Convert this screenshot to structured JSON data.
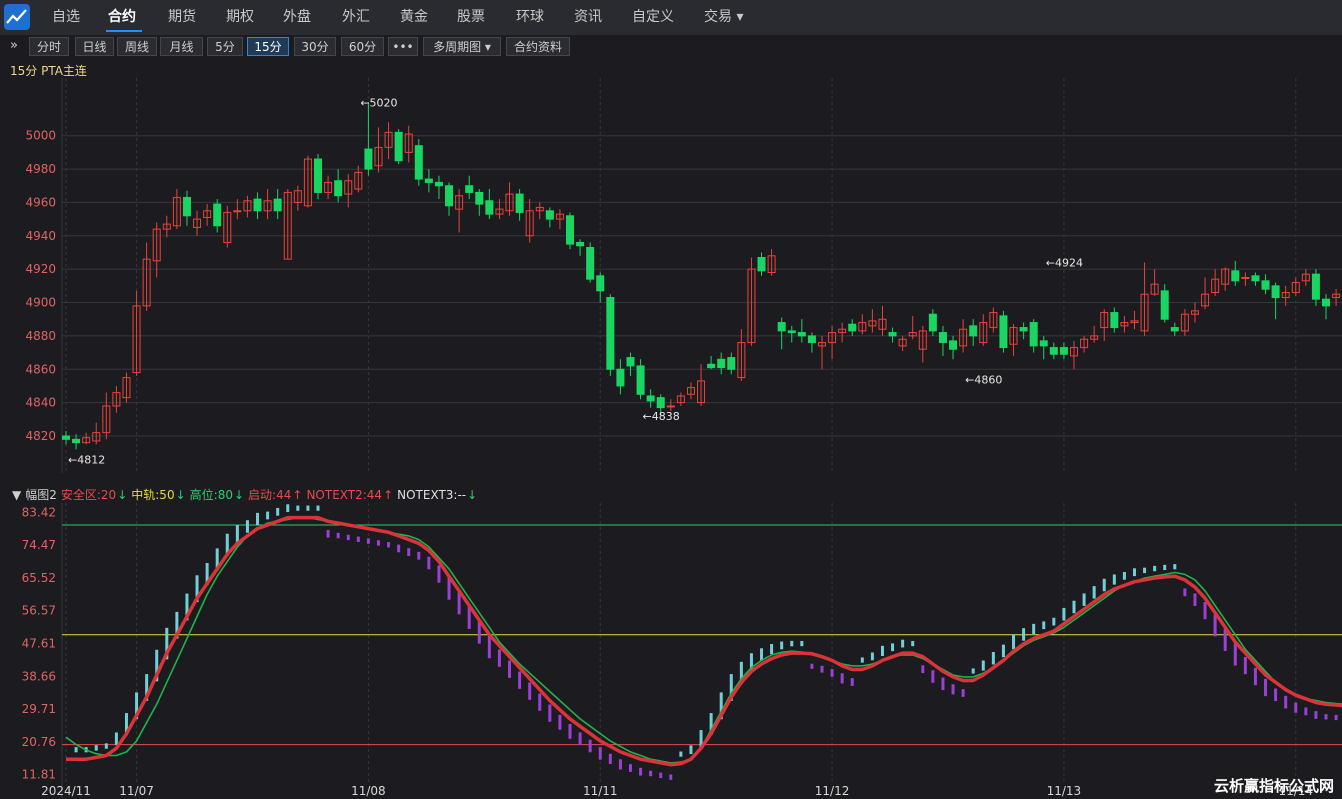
{
  "nav": {
    "items": [
      "自选",
      "合约",
      "期货",
      "期权",
      "外盘",
      "外汇",
      "黄金",
      "股票",
      "环球",
      "资讯",
      "自定义",
      "交易"
    ],
    "active": "合约"
  },
  "toolbar": {
    "collapse": "»",
    "buttons": [
      "分时",
      "日线",
      "周线",
      "月线",
      "5分",
      "15分",
      "30分",
      "60分",
      "•••",
      "多周期图",
      "合约资料"
    ],
    "active": "15分"
  },
  "chart_title": "15分 PTA主连",
  "indicator_legend": {
    "name": "幅图2",
    "items": [
      {
        "text": "安全区:20",
        "color": "#e84a4a",
        "arrow": "↓",
        "arrow_color": "#2ecc71"
      },
      {
        "text": "中轨:50",
        "color": "#e6d94a",
        "arrow": "↓",
        "arrow_color": "#2ecc71"
      },
      {
        "text": "高位:80",
        "color": "#2ecc71",
        "arrow": "↓",
        "arrow_color": "#2ecc71"
      },
      {
        "text": "启动:44",
        "color": "#e84a4a",
        "arrow": "↑",
        "arrow_color": "#e84a4a"
      },
      {
        "text": "NOTEXT2:44",
        "color": "#e84a4a",
        "arrow": "↑",
        "arrow_color": "#e84a4a"
      },
      {
        "text": "NOTEXT3:--",
        "color": "#e0e0e0",
        "arrow": "↓",
        "arrow_color": "#2ecc71"
      }
    ]
  },
  "watermark": "云析赢指标公式网",
  "colors": {
    "up": "#e8433a",
    "down": "#19d663",
    "grid": "#35363c",
    "axis_text": "#e06363"
  },
  "chart_data": [
    {
      "type": "candlestick",
      "title": "15分 PTA主连",
      "ylim": [
        4808,
        5025
      ],
      "yticks": [
        4820,
        4840,
        4860,
        4880,
        4900,
        4920,
        4940,
        4960,
        4980,
        5000
      ],
      "annotations": [
        {
          "label": "←5020",
          "index": 29,
          "value": 5020
        },
        {
          "label": "←4812",
          "index": 0,
          "value": 4812
        },
        {
          "label": "←4838",
          "index": 57,
          "value": 4838
        },
        {
          "label": "←4860",
          "index": 89,
          "value": 4860
        },
        {
          "label": "←4924",
          "index": 97,
          "value": 4924
        }
      ],
      "candles": [
        [
          4820,
          4818,
          4823,
          4815
        ],
        [
          4818,
          4816,
          4821,
          4812
        ],
        [
          4816,
          4819,
          4822,
          4815
        ],
        [
          4817,
          4822,
          4828,
          4815
        ],
        [
          4822,
          4838,
          4846,
          4818
        ],
        [
          4838,
          4846,
          4850,
          4834
        ],
        [
          4843,
          4855,
          4858,
          4840
        ],
        [
          4858,
          4898,
          4907,
          4856
        ],
        [
          4898,
          4926,
          4936,
          4895
        ],
        [
          4925,
          4944,
          4948,
          4915
        ],
        [
          4944,
          4947,
          4952,
          4939
        ],
        [
          4946,
          4963,
          4968,
          4944
        ],
        [
          4963,
          4952,
          4967,
          4946
        ],
        [
          4945,
          4950,
          4955,
          4940
        ],
        [
          4951,
          4955,
          4959,
          4946
        ],
        [
          4959,
          4946,
          4962,
          4942
        ],
        [
          4936,
          4954,
          4958,
          4933
        ],
        [
          4955,
          4955,
          4962,
          4950
        ],
        [
          4955,
          4961,
          4964,
          4951
        ],
        [
          4962,
          4955,
          4966,
          4950
        ],
        [
          4955,
          4961,
          4968,
          4950
        ],
        [
          4962,
          4955,
          4968,
          4950
        ],
        [
          4926,
          4966,
          4968,
          4926
        ],
        [
          4960,
          4967,
          4970,
          4955
        ],
        [
          4958,
          4986,
          4988,
          4957
        ],
        [
          4986,
          4966,
          4989,
          4962
        ],
        [
          4966,
          4972,
          4976,
          4962
        ],
        [
          4973,
          4964,
          4980,
          4960
        ],
        [
          4965,
          4973,
          4977,
          4957
        ],
        [
          4968,
          4978,
          4982,
          4966
        ],
        [
          4992,
          4980,
          5020,
          4976
        ],
        [
          4982,
          4993,
          5005,
          4978
        ],
        [
          4993,
          5002,
          5008,
          4986
        ],
        [
          5002,
          4985,
          5004,
          4983
        ],
        [
          4990,
          5001,
          5006,
          4984
        ],
        [
          4994,
          4974,
          4998,
          4970
        ],
        [
          4974,
          4972,
          4980,
          4966
        ],
        [
          4972,
          4970,
          4976,
          4962
        ],
        [
          4970,
          4958,
          4972,
          4952
        ],
        [
          4956,
          4964,
          4968,
          4942
        ],
        [
          4970,
          4966,
          4976,
          4962
        ],
        [
          4966,
          4959,
          4968,
          4952
        ],
        [
          4961,
          4953,
          4968,
          4950
        ],
        [
          4953,
          4956,
          4962,
          4950
        ],
        [
          4955,
          4965,
          4972,
          4952
        ],
        [
          4965,
          4954,
          4968,
          4949
        ],
        [
          4940,
          4955,
          4962,
          4936
        ],
        [
          4955,
          4957,
          4960,
          4950
        ],
        [
          4955,
          4950,
          4957,
          4945
        ],
        [
          4950,
          4953,
          4956,
          4944
        ],
        [
          4952,
          4935,
          4954,
          4932
        ],
        [
          4936,
          4934,
          4938,
          4928
        ],
        [
          4933,
          4914,
          4936,
          4912
        ],
        [
          4916,
          4907,
          4918,
          4900
        ],
        [
          4903,
          4860,
          4905,
          4856
        ],
        [
          4860,
          4850,
          4866,
          4845
        ],
        [
          4867,
          4862,
          4870,
          4856
        ],
        [
          4862,
          4845,
          4866,
          4842
        ],
        [
          4844,
          4841,
          4848,
          4837
        ],
        [
          4843,
          4837,
          4845,
          4832
        ],
        [
          4838,
          4838,
          4842,
          4835
        ],
        [
          4840,
          4844,
          4846,
          4838
        ],
        [
          4845,
          4849,
          4852,
          4842
        ],
        [
          4840,
          4853,
          4863,
          4838
        ],
        [
          4863,
          4861,
          4868,
          4860
        ],
        [
          4866,
          4861,
          4870,
          4857
        ],
        [
          4867,
          4860,
          4870,
          4857
        ],
        [
          4855,
          4876,
          4884,
          4853
        ],
        [
          4876,
          4920,
          4927,
          4874
        ],
        [
          4927,
          4919,
          4930,
          4916
        ],
        [
          4918,
          4928,
          4932,
          4916
        ],
        [
          4888,
          4883,
          4891,
          4872
        ],
        [
          4883,
          4882,
          4886,
          4876
        ],
        [
          4882,
          4880,
          4890,
          4876
        ],
        [
          4880,
          4876,
          4882,
          4870
        ],
        [
          4874,
          4876,
          4880,
          4860
        ],
        [
          4876,
          4882,
          4886,
          4866
        ],
        [
          4882,
          4884,
          4888,
          4876
        ],
        [
          4887,
          4883,
          4890,
          4880
        ],
        [
          4883,
          4888,
          4893,
          4881
        ],
        [
          4886,
          4889,
          4896,
          4882
        ],
        [
          4884,
          4890,
          4898,
          4880
        ],
        [
          4882,
          4880,
          4885,
          4876
        ],
        [
          4874,
          4878,
          4880,
          4871
        ],
        [
          4880,
          4882,
          4892,
          4878
        ],
        [
          4872,
          4883,
          4886,
          4864
        ],
        [
          4893,
          4883,
          4896,
          4880
        ],
        [
          4882,
          4876,
          4886,
          4868
        ],
        [
          4877,
          4872,
          4880,
          4866
        ],
        [
          4874,
          4884,
          4890,
          4870
        ],
        [
          4886,
          4880,
          4890,
          4874
        ],
        [
          4876,
          4888,
          4893,
          4874
        ],
        [
          4885,
          4894,
          4897,
          4882
        ],
        [
          4892,
          4873,
          4895,
          4870
        ],
        [
          4875,
          4885,
          4887,
          4868
        ],
        [
          4885,
          4883,
          4888,
          4878
        ],
        [
          4888,
          4874,
          4890,
          4870
        ],
        [
          4877,
          4874,
          4880,
          4866
        ],
        [
          4873,
          4869,
          4876,
          4866
        ],
        [
          4873,
          4869,
          4876,
          4866
        ],
        [
          4868,
          4873,
          4877,
          4860
        ],
        [
          4873,
          4878,
          4880,
          4870
        ],
        [
          4878,
          4880,
          4886,
          4876
        ],
        [
          4885,
          4894,
          4896,
          4877
        ],
        [
          4894,
          4885,
          4897,
          4882
        ],
        [
          4886,
          4888,
          4892,
          4882
        ],
        [
          4888,
          4889,
          4895,
          4884
        ],
        [
          4883,
          4905,
          4924,
          4880
        ],
        [
          4905,
          4911,
          4920,
          4904
        ],
        [
          4907,
          4890,
          4911,
          4888
        ],
        [
          4885,
          4883,
          4888,
          4880
        ],
        [
          4883,
          4893,
          4896,
          4880
        ],
        [
          4893,
          4895,
          4900,
          4888
        ],
        [
          4898,
          4905,
          4915,
          4896
        ],
        [
          4906,
          4914,
          4920,
          4904
        ],
        [
          4911,
          4920,
          4921,
          4907
        ],
        [
          4919,
          4913,
          4925,
          4910
        ],
        [
          4915,
          4915,
          4918,
          4910
        ],
        [
          4916,
          4913,
          4918,
          4910
        ],
        [
          4913,
          4908,
          4917,
          4905
        ],
        [
          4910,
          4903,
          4912,
          4890
        ],
        [
          4903,
          4906,
          4910,
          4898
        ],
        [
          4906,
          4912,
          4915,
          4904
        ],
        [
          4913,
          4917,
          4920,
          4910
        ],
        [
          4917,
          4902,
          4920,
          4898
        ],
        [
          4902,
          4898,
          4905,
          4890
        ],
        [
          4903,
          4905,
          4908,
          4898
        ],
        [
          4905,
          4892,
          4910,
          4890
        ],
        [
          4893,
          4886,
          4895,
          4883
        ],
        [
          4886,
          4872,
          4888,
          4866
        ],
        [
          4873,
          4872,
          4882,
          4868
        ],
        [
          4872,
          4864,
          4875,
          4858
        ],
        [
          4870,
          4862,
          4878,
          4858
        ],
        [
          4862,
          4852,
          4864,
          4848
        ],
        [
          4856,
          4867,
          4870,
          4854
        ],
        [
          4867,
          4868,
          4870,
          4860
        ],
        [
          4868,
          4866,
          4872,
          4858
        ],
        [
          4868,
          4862,
          4870,
          4860
        ],
        [
          4864,
          4851,
          4868,
          4848
        ]
      ],
      "x_dates": [
        {
          "index": 0,
          "label": "2024/11"
        },
        {
          "index": 7,
          "label": "11/07"
        },
        {
          "index": 30,
          "label": "11/08"
        },
        {
          "index": 53,
          "label": "11/11"
        },
        {
          "index": 76,
          "label": "11/12"
        },
        {
          "index": 99,
          "label": "11/13"
        },
        {
          "index": 122,
          "label": "11/14"
        }
      ]
    },
    {
      "type": "line",
      "title": "幅图2",
      "ylim": [
        9.5,
        86
      ],
      "yticks": [
        11.81,
        20.76,
        29.71,
        38.66,
        47.61,
        56.57,
        65.52,
        74.47,
        83.42
      ],
      "hlines": [
        {
          "name": "安全区",
          "value": 20,
          "color": "#e84a4a"
        },
        {
          "name": "中轨",
          "value": 50,
          "color": "#e6d94a"
        },
        {
          "name": "高位",
          "value": 80,
          "color": "#2ecc71"
        }
      ],
      "series": [
        {
          "name": "NOTEXT2",
          "color": "#d9343a",
          "values": [
            16,
            16,
            16,
            16.5,
            17,
            19,
            23,
            28,
            33,
            39,
            45,
            50,
            55,
            60,
            64,
            68,
            72,
            75,
            77,
            79,
            80,
            81,
            82,
            82,
            82,
            82,
            81,
            80.5,
            80,
            79.5,
            79,
            78.5,
            78,
            77,
            76,
            75,
            73,
            70,
            66,
            62,
            58,
            54,
            50,
            47,
            44,
            41,
            38,
            35,
            32,
            29.5,
            27,
            25,
            23,
            21,
            19.5,
            18,
            17,
            16,
            15.5,
            15,
            14.5,
            14.8,
            16,
            19,
            23,
            28,
            33,
            37,
            40,
            42,
            43.5,
            44.5,
            45,
            45,
            44.8,
            44,
            43,
            41.5,
            40.5,
            40.5,
            41.5,
            43,
            44,
            45,
            45,
            44,
            42,
            40,
            38.5,
            37.5,
            37.5,
            39,
            41,
            43,
            45.5,
            47.5,
            49,
            50,
            51,
            53,
            55,
            57,
            59,
            61,
            62.5,
            63.5,
            64.5,
            65,
            65.5,
            65.8,
            66,
            65,
            63,
            60,
            56,
            52,
            48,
            45,
            42,
            39,
            37,
            35,
            33.5,
            32.5,
            31.5,
            31,
            30.8,
            30.5,
            30.5,
            30.5,
            30.5
          ]
        },
        {
          "name": "NOTEXT3",
          "color": "#21b24a",
          "values": [
            22,
            20,
            18.5,
            17.5,
            17,
            17,
            18,
            21,
            26,
            31,
            37,
            43,
            49,
            55,
            61,
            66,
            70,
            74,
            77,
            79,
            80.5,
            81,
            81.5,
            82,
            82,
            81.5,
            81,
            80.5,
            80,
            79.5,
            79,
            78.5,
            78,
            77.5,
            77,
            76,
            74,
            71,
            68,
            64,
            60,
            56,
            52,
            48,
            45,
            42,
            39.5,
            37,
            34.5,
            32,
            29.5,
            27,
            25,
            23,
            21,
            19.5,
            18,
            17,
            16,
            15.5,
            15,
            15.2,
            16,
            19,
            24,
            29,
            34,
            38,
            41,
            43,
            44.5,
            45.2,
            45.5,
            45.3,
            44.8,
            44,
            43,
            42,
            41.5,
            41.5,
            42,
            43,
            44,
            44.5,
            44.5,
            43.5,
            42,
            40.5,
            39,
            38.5,
            38.5,
            39.5,
            41,
            43,
            45,
            47,
            48.5,
            49.5,
            50.5,
            52,
            54,
            56,
            58,
            60,
            62,
            63.5,
            64.5,
            65.5,
            66,
            66.5,
            67,
            66.5,
            65,
            62,
            58,
            54,
            50,
            46,
            43,
            40,
            37,
            35,
            33.5,
            32.5,
            32,
            31.5,
            31.2,
            31,
            31,
            31,
            31
          ]
        }
      ]
    }
  ]
}
